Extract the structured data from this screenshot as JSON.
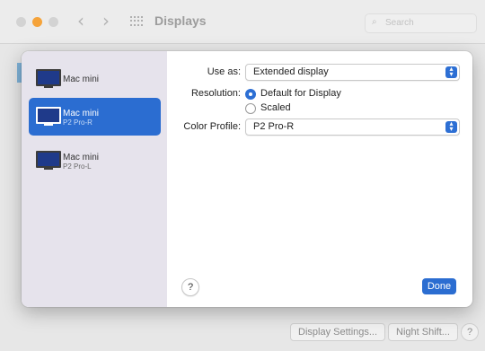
{
  "window": {
    "title": "Displays",
    "search_placeholder": "Search",
    "nav_back": "‹",
    "nav_forward": "›",
    "traffic_colors": {
      "close": "#d3d3d3",
      "minimize": "#f5a33a",
      "zoom": "#d3d3d3"
    }
  },
  "footer": {
    "display_settings_label": "Display Settings...",
    "night_shift_label": "Night Shift...",
    "help_label": "?"
  },
  "sheet": {
    "displays": [
      {
        "name": "Mac mini",
        "sub": "",
        "selected": false
      },
      {
        "name": "Mac mini",
        "sub": "P2 Pro-R",
        "selected": true
      },
      {
        "name": "Mac mini",
        "sub": "P2 Pro-L",
        "selected": false
      }
    ],
    "use_as": {
      "label": "Use as:",
      "value": "Extended display"
    },
    "resolution": {
      "label": "Resolution:",
      "options": [
        {
          "label": "Default for Display",
          "selected": true
        },
        {
          "label": "Scaled",
          "selected": false
        }
      ]
    },
    "color_profile": {
      "label": "Color Profile:",
      "value": "P2 Pro-R"
    },
    "help_label": "?",
    "done_label": "Done",
    "accent_color": "#2b6dd1"
  }
}
